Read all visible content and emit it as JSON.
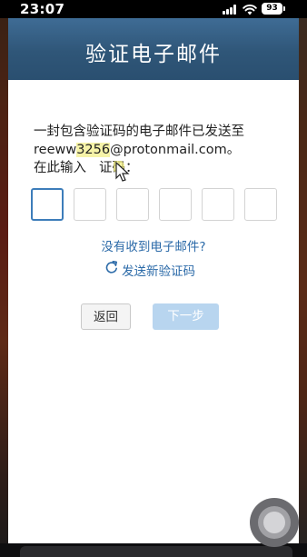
{
  "status_bar": {
    "time": "23:07",
    "battery_level": "93"
  },
  "dialog": {
    "title": "验证电子邮件",
    "message_line1": "一封包含验证码的电子邮件已发送至",
    "email_prefix": "reeww",
    "email_highlight": "3256",
    "email_suffix": "@protonmail.com。",
    "prompt_part1": "在此输入",
    "prompt_part2": "证码：",
    "code_digits": [
      "",
      "",
      "",
      "",
      "",
      ""
    ],
    "no_email_link": "没有收到电子邮件?",
    "resend_link": "发送新验证码",
    "back_button": "返回",
    "next_button": "下一步"
  },
  "colors": {
    "header": "#2f5678",
    "link": "#2b6aa8",
    "active_box_border": "#3d7dba",
    "next_disabled": "#b8d5ef"
  },
  "icons": [
    "signal-icon",
    "wifi-icon",
    "battery-icon",
    "mouse-cursor-icon",
    "refresh-icon",
    "assistive-touch-icon"
  ]
}
